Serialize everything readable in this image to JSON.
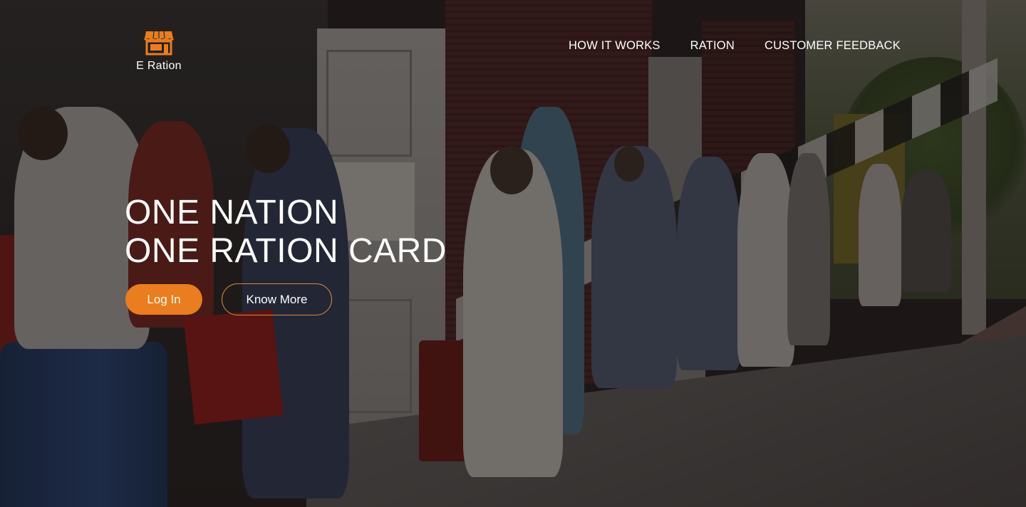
{
  "brand": {
    "name": "E Ration",
    "icon": "store-icon",
    "icon_color": "#ea7d1e"
  },
  "nav": {
    "items": [
      {
        "label": "HOW IT WORKS"
      },
      {
        "label": "RATION"
      },
      {
        "label": "CUSTOMER FEEDBACK"
      }
    ]
  },
  "hero": {
    "title_line1": "ONE NATION",
    "title_line2": "ONE RATION CARD",
    "login_label": "Log In",
    "know_more_label": "Know More",
    "background": "photo-people-queue-ration-shop"
  },
  "colors": {
    "accent": "#ea7d1e",
    "text": "#ffffff"
  }
}
